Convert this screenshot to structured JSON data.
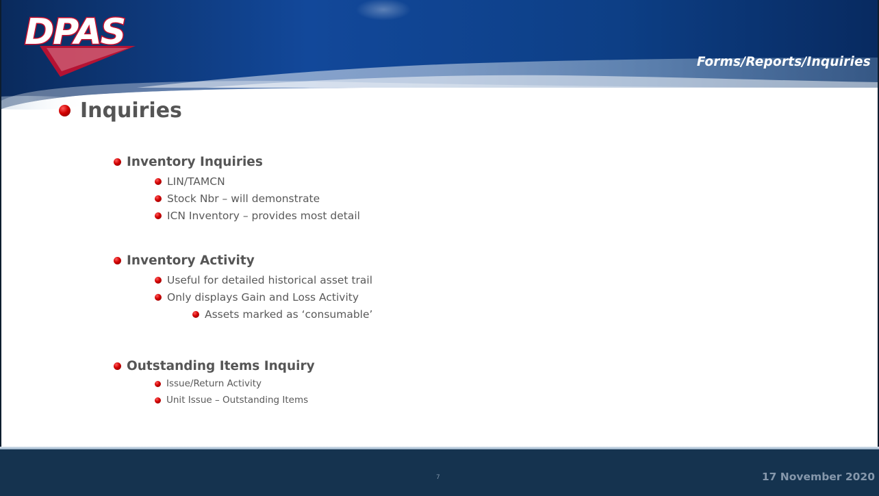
{
  "header": {
    "logo_text": "DPAS",
    "section_title": "Forms/Reports/Inquiries"
  },
  "main": {
    "title": "Inquiries",
    "groups": [
      {
        "heading": "Inventory Inquiries",
        "items": [
          "LIN/TAMCN",
          "Stock Nbr – will demonstrate",
          "ICN Inventory – provides most detail"
        ]
      },
      {
        "heading": "Inventory Activity",
        "items": [
          "Useful for detailed historical asset trail",
          "Only displays Gain and Loss Activity"
        ],
        "subitems": [
          "Assets marked as ‘consumable’"
        ]
      },
      {
        "heading": "Outstanding Items Inquiry",
        "items": [
          "Issue/Return Activity",
          "Unit Issue – Outstanding Items"
        ]
      }
    ]
  },
  "footer": {
    "page_number": "7",
    "date": "17 November 2020"
  },
  "colors": {
    "header_blue": "#0b3c7a",
    "footer_navy": "#15334f",
    "bullet_red": "#d10000",
    "logo_red": "#c8102e",
    "text_gray": "#555555"
  }
}
